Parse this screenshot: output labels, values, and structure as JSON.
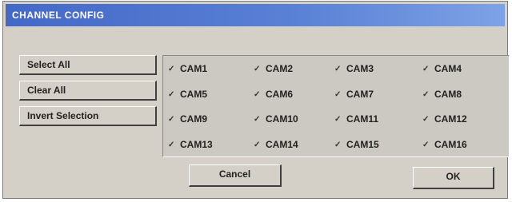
{
  "window": {
    "title": "CHANNEL CONFIG"
  },
  "buttons": {
    "select_all": "Select All",
    "clear_all": "Clear All",
    "invert_selection": "Invert Selection",
    "cancel": "Cancel",
    "ok": "OK"
  },
  "cameras": [
    {
      "label": "CAM1",
      "checked": true
    },
    {
      "label": "CAM2",
      "checked": true
    },
    {
      "label": "CAM3",
      "checked": true
    },
    {
      "label": "CAM4",
      "checked": true
    },
    {
      "label": "CAM5",
      "checked": true
    },
    {
      "label": "CAM6",
      "checked": true
    },
    {
      "label": "CAM7",
      "checked": true
    },
    {
      "label": "CAM8",
      "checked": true
    },
    {
      "label": "CAM9",
      "checked": true
    },
    {
      "label": "CAM10",
      "checked": true
    },
    {
      "label": "CAM11",
      "checked": true
    },
    {
      "label": "CAM12",
      "checked": true
    },
    {
      "label": "CAM13",
      "checked": true
    },
    {
      "label": "CAM14",
      "checked": true
    },
    {
      "label": "CAM15",
      "checked": true
    },
    {
      "label": "CAM16",
      "checked": true
    }
  ]
}
